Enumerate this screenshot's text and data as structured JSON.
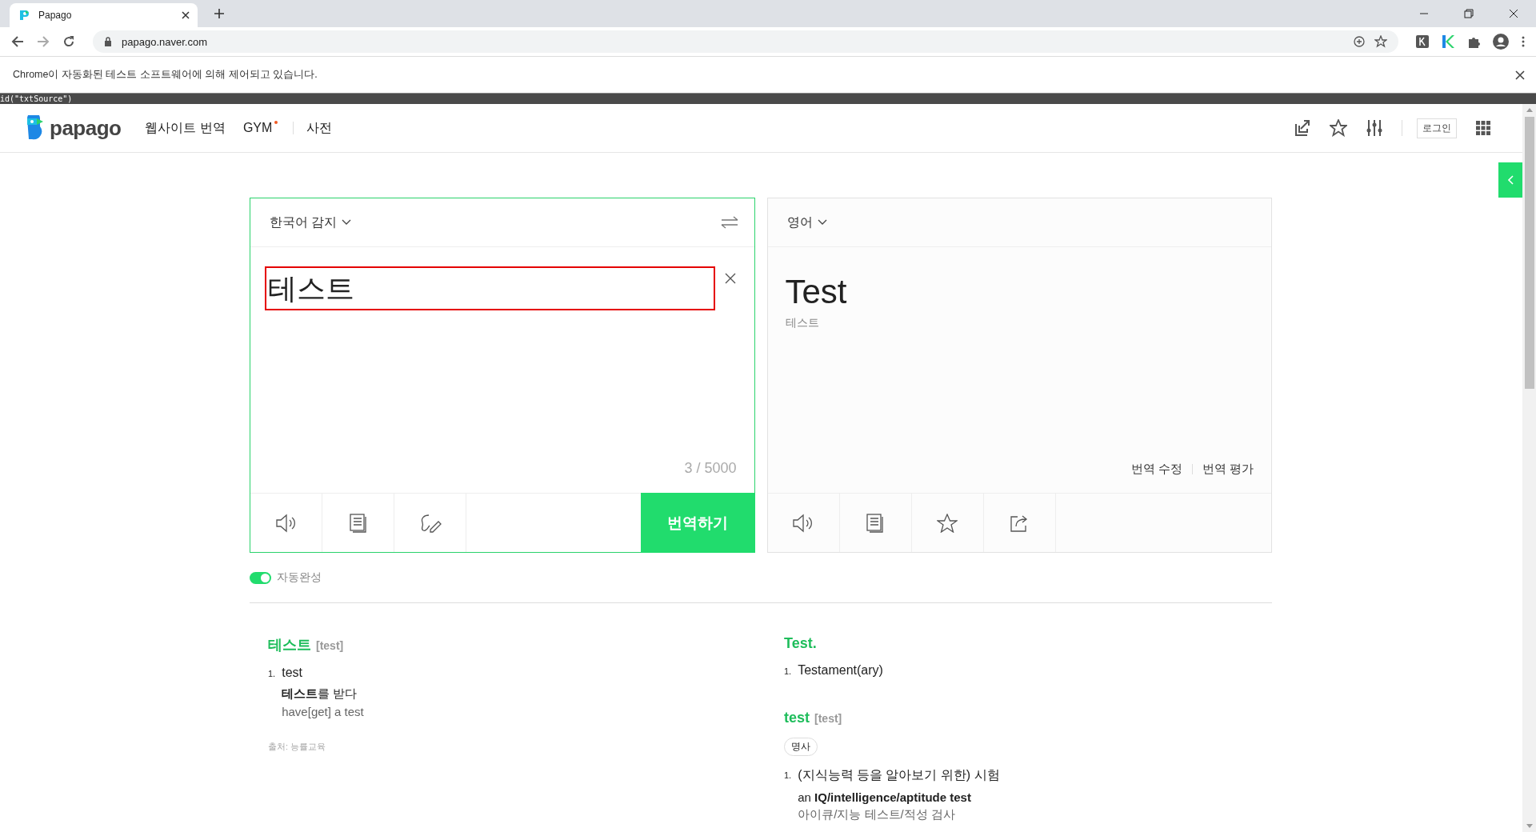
{
  "browser": {
    "tab_title": "Papago",
    "url": "papago.naver.com",
    "infobar": "Chrome이 자동화된 테스트 소프트웨어에 의해 제어되고 있습니다.",
    "devbar": "id(\"txtSource\")"
  },
  "header": {
    "logo": "papago",
    "nav": [
      {
        "label": "웹사이트 번역",
        "dot": false
      },
      {
        "label": "GYM",
        "dot": true
      },
      {
        "label": "사전",
        "dot": false
      }
    ],
    "login": "로그인"
  },
  "source": {
    "language": "한국어 감지",
    "text": "테스트",
    "highlighted": true,
    "count": "3 / 5000",
    "translate_button": "번역하기"
  },
  "target": {
    "language": "영어",
    "text": "Test",
    "pronunciation": "테스트",
    "links": [
      "번역 수정",
      "번역 평가"
    ]
  },
  "autocomplete": {
    "label": "자동완성",
    "on": true
  },
  "dictionary": {
    "left": {
      "entries": [
        {
          "headword": "테스트",
          "pron": "[test]",
          "senses": [
            {
              "num": "1.",
              "meaning": "test",
              "examples": [
                {
                  "text": "**테스트**를 받다",
                  "translation": "have[get] a test"
                }
              ]
            }
          ]
        }
      ],
      "source": "출처: 능률교육"
    },
    "right": {
      "entries": [
        {
          "headword": "Test.",
          "senses": [
            {
              "num": "1.",
              "meaning": "Testament(ary)"
            }
          ]
        },
        {
          "headword": "test",
          "pron": "[test]",
          "pos": "명사",
          "senses": [
            {
              "num": "1.",
              "meaning": "(지식능력 등을 알아보기 위한) 시험",
              "examples": [
                {
                  "text": "an **IQ/intelligence/aptitude test**",
                  "translation": "아이큐/지능 테스트/적성 검사"
                }
              ]
            }
          ]
        }
      ]
    }
  }
}
